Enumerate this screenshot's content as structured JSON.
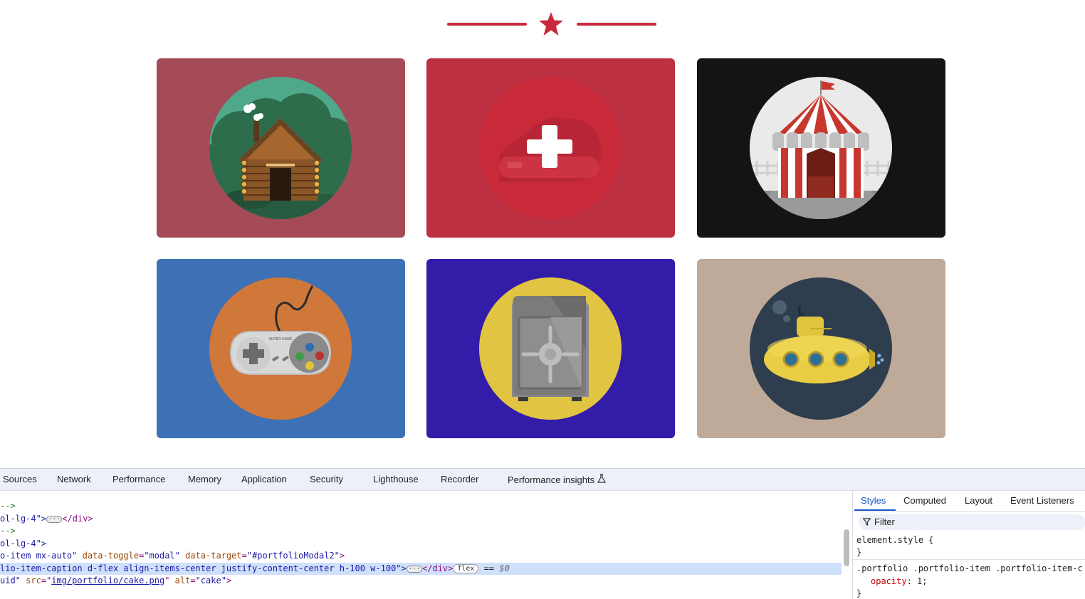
{
  "colors": {
    "accent": "#c82a3c",
    "card_cabin": "#a54b58",
    "card_cake": "#bd3042",
    "card_circus": "#141414",
    "card_game": "#3e70b6",
    "card_safe": "#321ca8",
    "card_submarine": "#bfa998"
  },
  "portfolio": {
    "items": [
      {
        "name": "cabin",
        "icon": "log-cabin-icon"
      },
      {
        "name": "cake",
        "icon": "cake-icon"
      },
      {
        "name": "circus",
        "icon": "circus-tent-icon"
      },
      {
        "name": "game",
        "icon": "game-controller-icon"
      },
      {
        "name": "safe",
        "icon": "safe-icon"
      },
      {
        "name": "submarine",
        "icon": "submarine-icon"
      }
    ],
    "controller_brand": "SUPER GAME"
  },
  "devtools": {
    "tabs": [
      "Sources",
      "Network",
      "Performance",
      "Memory",
      "Application",
      "Security",
      "Lighthouse",
      "Recorder",
      "Performance insights"
    ],
    "elements": {
      "line1": "-->",
      "line2_a": "ol-lg-4\">",
      "line2_b": "</div>",
      "line3": "-->",
      "line4": "ol-lg-4\">",
      "line5_a": "o-item mx-auto\" ",
      "line5_attr1": "data-toggle",
      "line5_val1": "\"modal\"",
      "line5_attr2": "data-target",
      "line5_val2": "\"#portfolioModal2\"",
      "line5_end": ">",
      "line6_a": "lio-item-caption d-flex align-items-center justify-content-center h-100 w-100\">",
      "line6_b": "</div>",
      "line6_pill": "flex",
      "line6_eq": "==",
      "line6_dollar": "$0",
      "line7_a": "uid\" ",
      "line7_attr1": "src",
      "line7_val1": "img/portfolio/cake.png",
      "line7_attr2": "alt",
      "line7_val2": "\"cake\"",
      "line7_end": ">"
    },
    "styles": {
      "tabs": [
        "Styles",
        "Computed",
        "Layout",
        "Event Listeners"
      ],
      "filter_placeholder": "Filter",
      "rule1_selector": "element.style {",
      "rule1_close": "}",
      "rule2_selector": ".portfolio .portfolio-item .portfolio-item-c",
      "rule2_prop": "opacity",
      "rule2_value": ": 1;",
      "rule2_close": "}"
    }
  }
}
